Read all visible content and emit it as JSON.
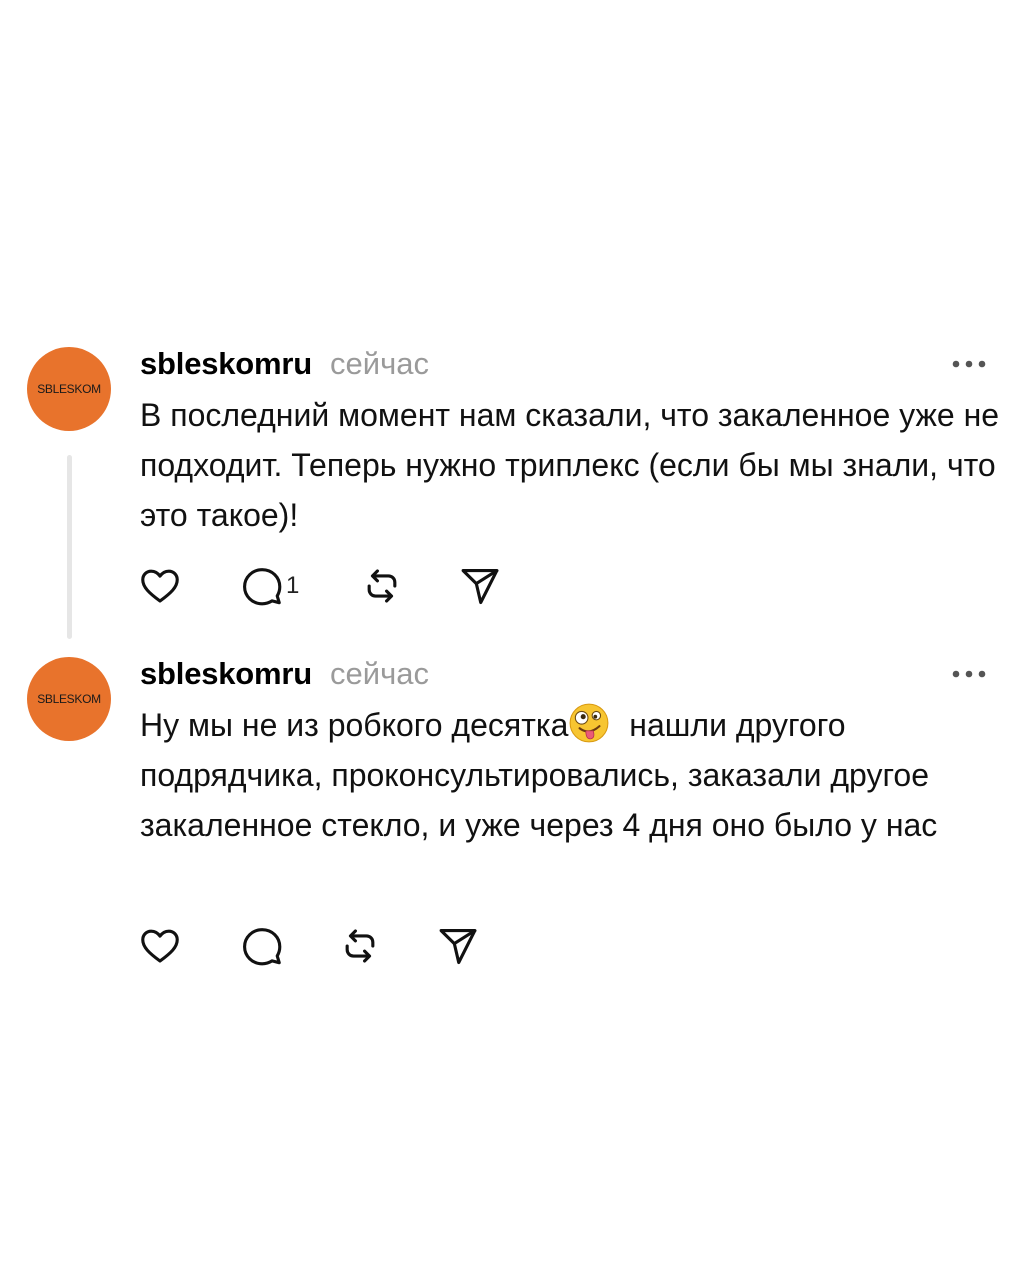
{
  "posts": [
    {
      "avatar_text": "SBLESKOM",
      "username": "sbleskomru",
      "time": "сейчас",
      "text": "В последний момент нам сказали, что закаленное уже не подходит. Теперь нужно триплекс (если бы мы знали, что это такое)!",
      "reply_count": "1"
    },
    {
      "avatar_text": "SBLESKOM",
      "username": "sbleskomru",
      "time": "сейчас",
      "text_before_emoji": "Ну мы не из робкого десятка",
      "emoji": "zany-face-emoji",
      "text_after_emoji": " нашли другого подрядчика, проконсультировались, заказали другое закаленное стекло, и уже через 4 дня оно было у нас"
    }
  ],
  "icons": {
    "like": "heart-icon",
    "reply": "comment-bubble-icon",
    "repost": "repost-icon",
    "share": "send-icon",
    "more": "more-options-icon"
  },
  "colors": {
    "avatar_background": "#e8732c",
    "muted_text": "#9a9a9a",
    "thread_line": "#e6e6e6"
  }
}
